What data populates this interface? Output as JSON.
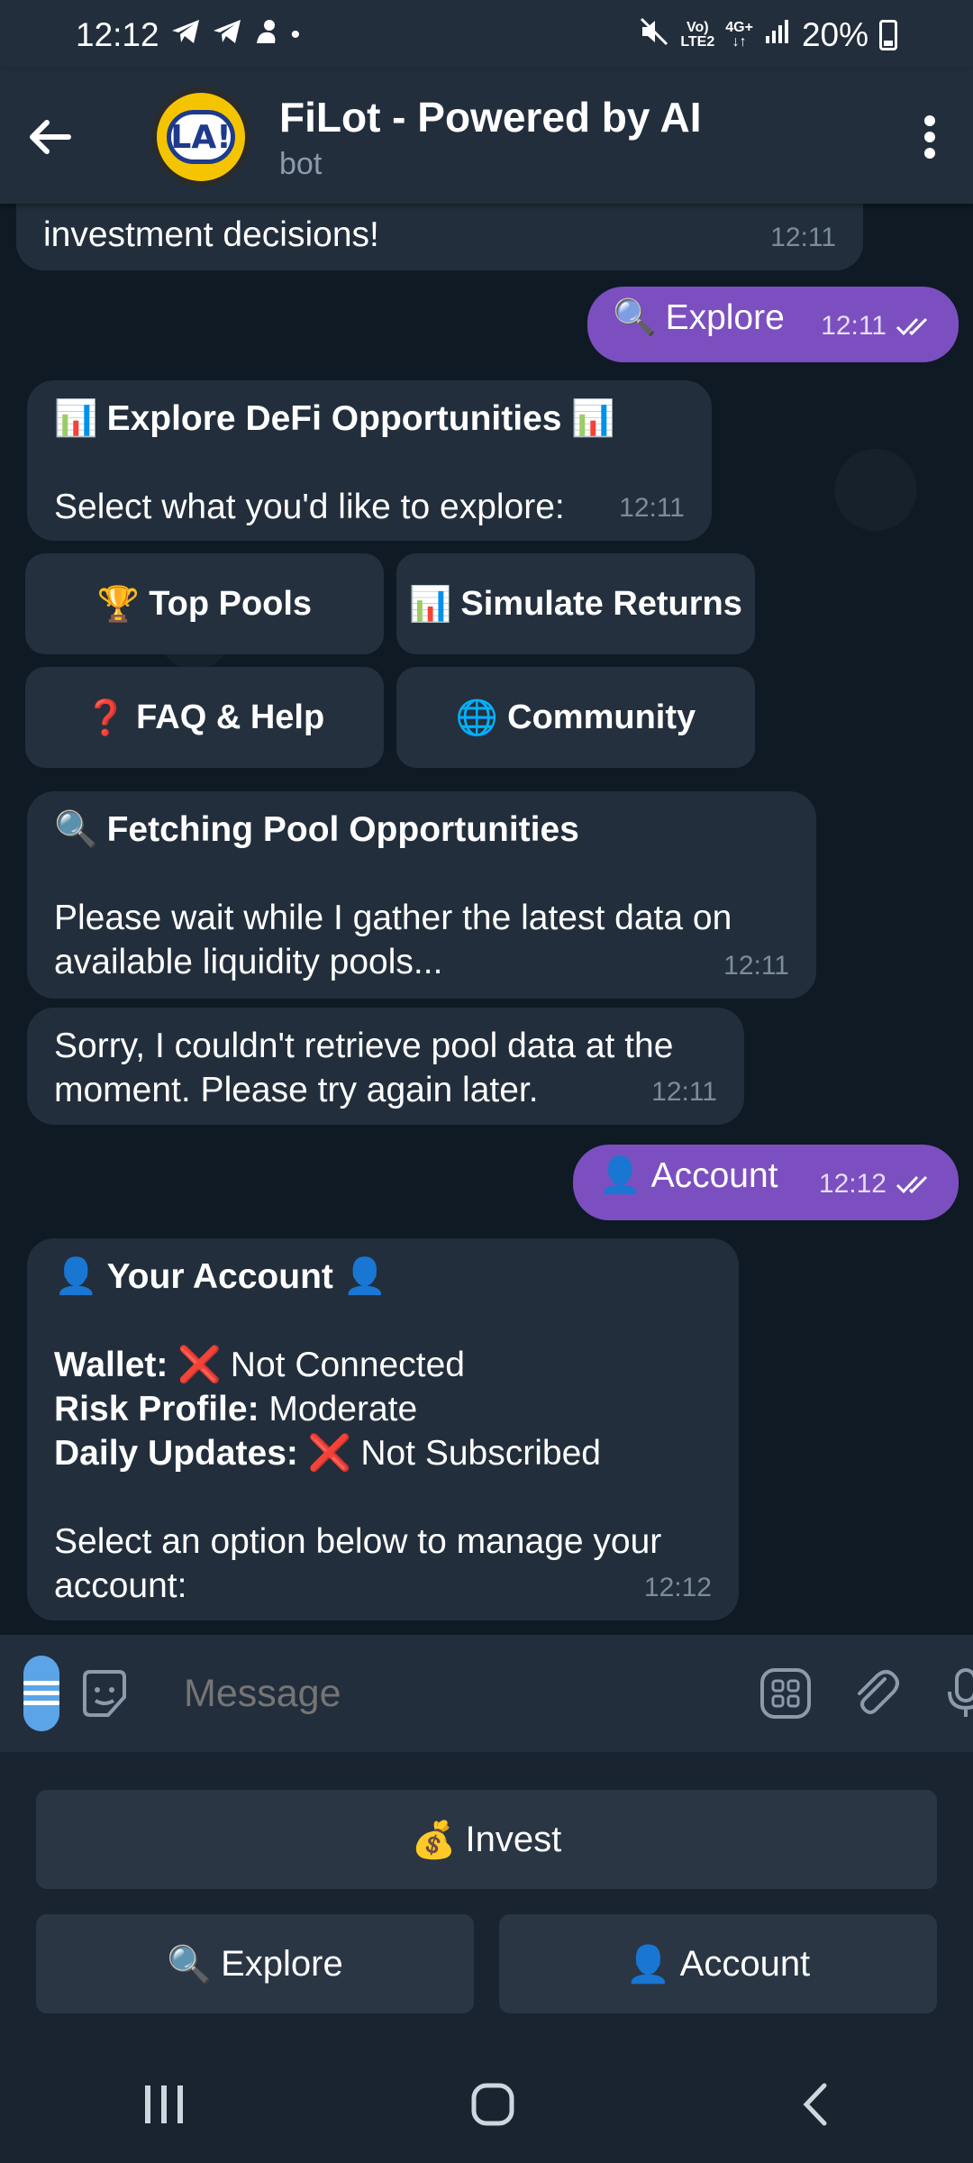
{
  "status_bar": {
    "time": "12:12",
    "battery": "20%",
    "network_top": "Vo)",
    "network_bottom": "LTE2",
    "data_top": "4G+",
    "data_bottom": "↓↑",
    "dot": "•"
  },
  "header": {
    "title": "FiLot - Powered by AI",
    "subtitle": "bot",
    "avatar_text": "LA!"
  },
  "messages": [
    {
      "text": "investment decisions!",
      "time": "12:11"
    },
    {
      "icon": "🔍",
      "text": "Explore",
      "time": "12:11"
    },
    {
      "heading": "Explore DeFi Opportunities",
      "body": "Select what you'd like to explore:",
      "time": "12:11"
    },
    {
      "heading": "Fetching Pool Opportunities",
      "body_line1": "Please wait while I gather the latest data on",
      "body_line2": "available liquidity pools...",
      "time": "12:11"
    },
    {
      "line1": "Sorry, I couldn't retrieve pool data at the",
      "line2": "moment. Please try again later.",
      "time": "12:11"
    },
    {
      "icon": "👤",
      "text": "Account",
      "time": "12:12"
    },
    {
      "heading": "Your Account",
      "wallet_label": "Wallet:",
      "wallet_value": "Not Connected",
      "risk_label": "Risk Profile:",
      "risk_value": "Moderate",
      "updates_label": "Daily Updates:",
      "updates_value": "Not Subscribed",
      "footer_line1": "Select an option below to manage your",
      "footer_line2": "account:",
      "time": "12:12"
    }
  ],
  "inline_keyboard": [
    {
      "icon": "🏆",
      "label": "Top Pools"
    },
    {
      "icon": "📊",
      "label": "Simulate Returns"
    },
    {
      "icon": "❓",
      "label": "FAQ & Help"
    },
    {
      "icon": "🌐",
      "label": "Community"
    }
  ],
  "input": {
    "placeholder": "Message"
  },
  "reply_keyboard": [
    {
      "icon": "💰",
      "label": "Invest"
    },
    {
      "icon": "🔍",
      "label": "Explore"
    },
    {
      "icon": "👤",
      "label": "Account"
    }
  ],
  "emoji": {
    "chart": "📊",
    "magnifier": "🔍",
    "user": "👤",
    "cross": "❌"
  },
  "colors": {
    "outgoing_bubble": "#7c4fc0",
    "incoming_bubble": "#222e3b",
    "accent": "#5ba4e8",
    "chat_bg": "#0f1a24"
  }
}
